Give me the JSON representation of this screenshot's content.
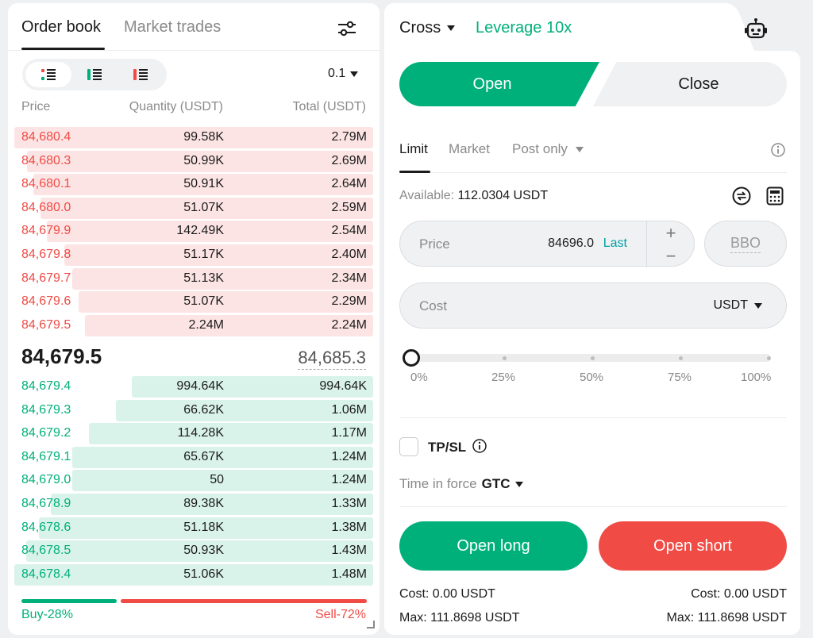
{
  "orderbook": {
    "tabs": [
      "Order book",
      "Market trades"
    ],
    "precision": "0.1",
    "columns": [
      "Price",
      "Quantity (USDT)",
      "Total (USDT)"
    ],
    "asks": [
      {
        "price": "84,680.4",
        "qty": "99.58K",
        "total": "2.79M",
        "depth": 1.0
      },
      {
        "price": "84,680.3",
        "qty": "50.99K",
        "total": "2.69M",
        "depth": 0.964
      },
      {
        "price": "84,680.1",
        "qty": "50.91K",
        "total": "2.64M",
        "depth": 0.946
      },
      {
        "price": "84,680.0",
        "qty": "51.07K",
        "total": "2.59M",
        "depth": 0.928
      },
      {
        "price": "84,679.9",
        "qty": "142.49K",
        "total": "2.54M",
        "depth": 0.91
      },
      {
        "price": "84,679.8",
        "qty": "51.17K",
        "total": "2.40M",
        "depth": 0.86
      },
      {
        "price": "84,679.7",
        "qty": "51.13K",
        "total": "2.34M",
        "depth": 0.839
      },
      {
        "price": "84,679.6",
        "qty": "51.07K",
        "total": "2.29M",
        "depth": 0.821
      },
      {
        "price": "84,679.5",
        "qty": "2.24M",
        "total": "2.24M",
        "depth": 0.803
      }
    ],
    "last_price": "84,679.5",
    "mark_price": "84,685.3",
    "bids": [
      {
        "price": "84,679.4",
        "qty": "994.64K",
        "total": "994.64K",
        "depth": 0.672
      },
      {
        "price": "84,679.3",
        "qty": "66.62K",
        "total": "1.06M",
        "depth": 0.716
      },
      {
        "price": "84,679.2",
        "qty": "114.28K",
        "total": "1.17M",
        "depth": 0.791
      },
      {
        "price": "84,679.1",
        "qty": "65.67K",
        "total": "1.24M",
        "depth": 0.838
      },
      {
        "price": "84,679.0",
        "qty": "50",
        "total": "1.24M",
        "depth": 0.838
      },
      {
        "price": "84,678.9",
        "qty": "89.38K",
        "total": "1.33M",
        "depth": 0.899
      },
      {
        "price": "84,678.6",
        "qty": "51.18K",
        "total": "1.38M",
        "depth": 0.932
      },
      {
        "price": "84,678.5",
        "qty": "50.93K",
        "total": "1.43M",
        "depth": 0.966
      },
      {
        "price": "84,678.4",
        "qty": "51.06K",
        "total": "1.48M",
        "depth": 1.0
      }
    ],
    "buy_ratio": 0.28,
    "buy_label": "Buy-28%",
    "sell_label": "Sell-72%"
  },
  "trade": {
    "margin_mode": "Cross",
    "leverage": "Leverage 10x",
    "open_label": "Open",
    "close_label": "Close",
    "order_types": [
      "Limit",
      "Market",
      "Post only"
    ],
    "available_label": "Available:",
    "available_value": "112.0304 USDT",
    "price_label": "Price",
    "price_value": "84696.0",
    "price_last": "Last",
    "plus": "+",
    "minus": "−",
    "bbo": "BBO",
    "cost_placeholder": "Cost",
    "cost_unit": "USDT",
    "slider_value": 0,
    "slider_labels": [
      "0%",
      "25%",
      "50%",
      "75%",
      "100%"
    ],
    "tpsl_label": "TP/SL",
    "tif_label": "Time in force",
    "tif_value": "GTC",
    "open_long": "Open long",
    "open_short": "Open short",
    "long_cost": "Cost: 0.00 USDT",
    "long_max": "Max: 111.8698 USDT",
    "short_cost": "Cost: 0.00 USDT",
    "short_max": "Max: 111.8698 USDT"
  },
  "colors": {
    "buy": "#00b07a",
    "sell": "#f04b45",
    "accent_link": "#00a0a6"
  },
  "icons": [
    "filter-icon",
    "view-both-icon",
    "view-bids-icon",
    "view-asks-icon",
    "bot-icon",
    "info-icon",
    "swap-icon",
    "calculator-icon"
  ]
}
